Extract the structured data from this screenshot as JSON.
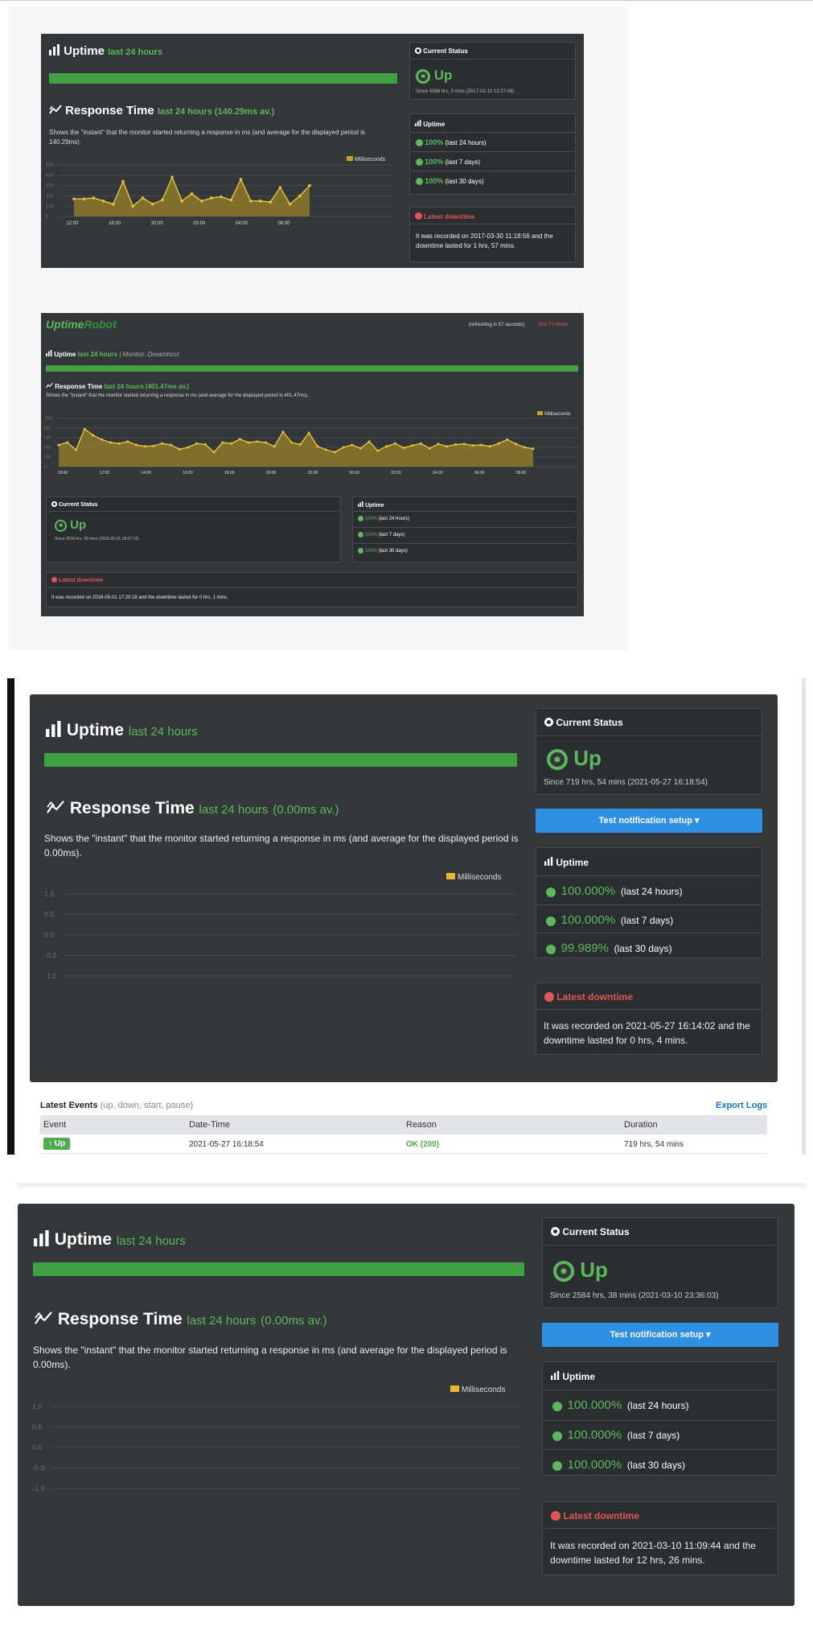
{
  "colors": {
    "panel": "#34373a",
    "green": "#5cb85c",
    "red": "#e25555",
    "chart": "#c9a227",
    "blue": "#2f8fe3"
  },
  "s1": {
    "uptime_title": "Uptime",
    "uptime_sub": "last 24 hours",
    "rt_title": "Response Time",
    "rt_sub": "last 24 hours (140.29ms av.)",
    "rt_desc": "Shows the \"instant\" that the monitor started returning a response in ms (and average for the displayed period is 140.29ms).",
    "legend": "Milliseconds",
    "status_title": "Current Status",
    "status": "Up",
    "status_since": "Since 4396 hrs, 3 mins (2017-03-10 12:27:06)",
    "uptime_box_title": "Uptime",
    "uptimes": [
      {
        "pct": "100%",
        "period": "(last 24 hours)"
      },
      {
        "pct": "100%",
        "period": "(last 7 days)"
      },
      {
        "pct": "100%",
        "period": "(last 30 days)"
      }
    ],
    "down_title": "Latest downtime",
    "down_text": "It was recorded on 2017-03-30 11:18:56 and the downtime lasted for 1 hrs, 57 mins."
  },
  "s2": {
    "logo_a": "Uptime",
    "logo_b": "Robot",
    "refresh": "(refreshing in 57 seconds)",
    "exit": "Exit TV Mode",
    "uptime_title": "Uptime",
    "uptime_sub": "last 24 hours",
    "monitor_label": "Monitor:",
    "monitor_name": "Dreamhost",
    "rt_title": "Response Time",
    "rt_sub": "last 24 hours (401.47ms av.)",
    "rt_desc": "Shows the \"instant\" that the monitor started returning a response in ms (and average for the displayed period is 401.47ms).",
    "legend": "Milliseconds",
    "status_title": "Current Status",
    "status": "Up",
    "status_since": "Since 3016 hrs, 39 mins (2018-05-01 18:07:19)",
    "uptime_box_title": "Uptime",
    "uptimes": [
      {
        "pct": "100%",
        "period": "(last 24 hours)"
      },
      {
        "pct": "100%",
        "period": "(last 7 days)"
      },
      {
        "pct": "100%",
        "period": "(last 30 days)"
      }
    ],
    "down_title": "Latest downtime",
    "down_text": "It was recorded on 2018-05-01 17:20:18 and the downtime lasted for 0 hrs, 1 mins."
  },
  "s3": {
    "uptime_title": "Uptime",
    "uptime_sub": "last 24 hours",
    "rt_title": "Response Time",
    "rt_sub": "last 24 hours",
    "rt_avg": "(0.00ms av.)",
    "rt_desc": "Shows the \"instant\" that the monitor started returning a response in ms (and average for the displayed period is 0.00ms).",
    "legend": "Milliseconds",
    "status_title": "Current Status",
    "status": "Up",
    "status_since": "Since 719 hrs, 54 mins (2021-05-27 16:18:54)",
    "test_btn": "Test notification setup ▾",
    "uptime_box_title": "Uptime",
    "uptimes": [
      {
        "pct": "100.000%",
        "period": "(last 24 hours)"
      },
      {
        "pct": "100.000%",
        "period": "(last 7 days)"
      },
      {
        "pct": "99.989%",
        "period": "(last 30 days)"
      }
    ],
    "down_title": "Latest downtime",
    "down_text": "It was recorded on 2021-05-27 16:14:02 and the downtime lasted for 0 hrs, 4 mins.",
    "events_title": "Latest Events",
    "events_sub": "(up, down, start, pause)",
    "export": "Export Logs",
    "events_headers": [
      "Event",
      "Date-Time",
      "Reason",
      "Duration"
    ],
    "events": [
      {
        "event": "Up",
        "datetime": "2021-05-27 16:18:54",
        "reason": "OK (200)",
        "duration": "719 hrs, 54 mins"
      }
    ]
  },
  "s4": {
    "uptime_title": "Uptime",
    "uptime_sub": "last 24 hours",
    "rt_title": "Response Time",
    "rt_sub": "last 24 hours",
    "rt_avg": "(0.00ms av.)",
    "rt_desc": "Shows the \"instant\" that the monitor started returning a response in ms (and average for the displayed period is 0.00ms).",
    "legend": "Milliseconds",
    "status_title": "Current Status",
    "status": "Up",
    "status_since": "Since 2584 hrs, 38 mins (2021-03-10 23:36:03)",
    "test_btn": "Test notification setup ▾",
    "uptime_box_title": "Uptime",
    "uptimes": [
      {
        "pct": "100.000%",
        "period": "(last 24 hours)"
      },
      {
        "pct": "100.000%",
        "period": "(last 7 days)"
      },
      {
        "pct": "100.000%",
        "period": "(last 30 days)"
      }
    ],
    "down_title": "Latest downtime",
    "down_text": "It was recorded on 2021-03-10 11:09:44 and the downtime lasted for 12 hrs, 26 mins."
  },
  "chart_data": [
    {
      "type": "area",
      "title": "",
      "xlabel": "",
      "ylabel": "",
      "x_ticks": [
        "12:00",
        "16:00",
        "20:00",
        "00:00",
        "04:00",
        "08:00"
      ],
      "y_ticks": [
        "500",
        "400",
        "300",
        "200",
        "100",
        "0"
      ],
      "ylim": [
        0,
        500
      ],
      "series": [
        {
          "name": "Milliseconds",
          "values": [
            170,
            170,
            180,
            150,
            120,
            340,
            100,
            180,
            120,
            160,
            380,
            150,
            220,
            150,
            180,
            190,
            160,
            360,
            150,
            150,
            140,
            280,
            120,
            200,
            300
          ]
        }
      ]
    },
    {
      "type": "area",
      "title": "",
      "xlabel": "",
      "ylabel": "",
      "x_ticks": [
        "10:00",
        "12:00",
        "14:00",
        "16:00",
        "18:00",
        "20:00",
        "22:00",
        "00:00",
        "02:00",
        "04:00",
        "06:00",
        "08:00"
      ],
      "y_ticks": [
        "1000",
        "800",
        "600",
        "400",
        "200",
        "0"
      ],
      "ylim": [
        0,
        1000
      ],
      "series": [
        {
          "name": "Milliseconds",
          "values": [
            450,
            500,
            350,
            780,
            650,
            560,
            500,
            480,
            520,
            450,
            420,
            430,
            480,
            450,
            360,
            400,
            480,
            460,
            300,
            500,
            480,
            570,
            500,
            520,
            500,
            420,
            720,
            500,
            460,
            700,
            420,
            350,
            300,
            400,
            450,
            380,
            520,
            330,
            420,
            480,
            390,
            440,
            480,
            380,
            470,
            420,
            460,
            470,
            440,
            450,
            420,
            480,
            560,
            470,
            400,
            370
          ]
        }
      ]
    },
    {
      "type": "line",
      "title": "",
      "xlabel": "",
      "ylabel": "",
      "y_ticks": [
        "1.0",
        "0.5",
        "0.0",
        "-0.5",
        "-1.0"
      ],
      "ylim": [
        -1,
        1
      ],
      "series": [
        {
          "name": "Milliseconds",
          "values": []
        }
      ]
    },
    {
      "type": "line",
      "title": "",
      "xlabel": "",
      "ylabel": "",
      "y_ticks": [
        "1.0",
        "0.5",
        "0.0",
        "-0.5",
        "-1.0"
      ],
      "ylim": [
        -1,
        1
      ],
      "series": [
        {
          "name": "Milliseconds",
          "values": []
        }
      ]
    }
  ]
}
